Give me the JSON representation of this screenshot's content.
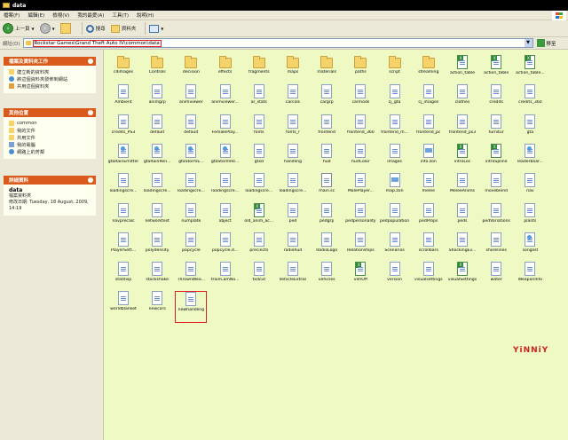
{
  "window": {
    "title": "data"
  },
  "menu": [
    "檔案(F)",
    "編輯(E)",
    "檢視(V)",
    "我的最愛(A)",
    "工具(T)",
    "說明(H)"
  ],
  "toolbar": {
    "back": "上一頁",
    "search": "搜尋",
    "folders": "資料夾"
  },
  "address": {
    "label": "網址(D)",
    "path": "Rockstar Games\\Grand Theft Auto IV\\common\\data",
    "go": "移至"
  },
  "tasks_panel": {
    "title": "檔案及資料夾工作",
    "items": [
      "建立新的資料夾",
      "將這個資料夾發佈到網站",
      "共用這個資料夾"
    ]
  },
  "other_panel": {
    "title": "其他位置",
    "items": [
      "common",
      "我的文件",
      "共用文件",
      "我的電腦",
      "網路上的芳鄰"
    ]
  },
  "details_panel": {
    "title": "詳細資料",
    "name": "data",
    "type": "檔案資料夾",
    "modified": "修改日期: Tuesday, 18 August, 2009, 14:19"
  },
  "watermark": "YiNNiY",
  "files": [
    {
      "label": "cdimages",
      "kind": "folder"
    },
    {
      "label": "Controls",
      "kind": "folder"
    },
    {
      "label": "decision",
      "kind": "folder"
    },
    {
      "label": "effects",
      "kind": "folder"
    },
    {
      "label": "fragments",
      "kind": "folder"
    },
    {
      "label": "maps",
      "kind": "folder"
    },
    {
      "label": "materials",
      "kind": "folder"
    },
    {
      "label": "paths",
      "kind": "folder"
    },
    {
      "label": "script",
      "kind": "folder"
    },
    {
      "label": "streaming",
      "kind": "folder"
    },
    {
      "label": "action_table",
      "kind": "xls"
    },
    {
      "label": "action_table",
      "kind": "xls"
    },
    {
      "label": "action_table...",
      "kind": "xls"
    },
    {
      "label": "Ambient",
      "kind": "file"
    },
    {
      "label": "animgrp",
      "kind": "file"
    },
    {
      "label": "animviewer",
      "kind": "file"
    },
    {
      "label": "animviewer...",
      "kind": "file"
    },
    {
      "label": "ar_stats",
      "kind": "file"
    },
    {
      "label": "carcols",
      "kind": "file"
    },
    {
      "label": "cargrp",
      "kind": "file"
    },
    {
      "label": "carmods",
      "kind": "file"
    },
    {
      "label": "cj_gta",
      "kind": "file"
    },
    {
      "label": "cj_images",
      "kind": "file"
    },
    {
      "label": "clothes",
      "kind": "file"
    },
    {
      "label": "credits",
      "kind": "file"
    },
    {
      "label": "credits_360",
      "kind": "file"
    },
    {
      "label": "credits_PS3",
      "kind": "file"
    },
    {
      "label": "default",
      "kind": "file"
    },
    {
      "label": "default",
      "kind": "file"
    },
    {
      "label": "FemalePlay...",
      "kind": "file"
    },
    {
      "label": "fonts",
      "kind": "file"
    },
    {
      "label": "fonts_r",
      "kind": "file"
    },
    {
      "label": "frontend",
      "kind": "file"
    },
    {
      "label": "frontend_360",
      "kind": "file"
    },
    {
      "label": "frontend_m...",
      "kind": "file"
    },
    {
      "label": "frontend_pc",
      "kind": "file"
    },
    {
      "label": "frontend_ps3",
      "kind": "file"
    },
    {
      "label": "furnitur",
      "kind": "file"
    },
    {
      "label": "gta",
      "kind": "file"
    },
    {
      "label": "gtaRainEmitter",
      "kind": "cfg"
    },
    {
      "label": "gtaRainRen...",
      "kind": "cfg"
    },
    {
      "label": "gtaStormE...",
      "kind": "cfg"
    },
    {
      "label": "gtaStormRe...",
      "kind": "cfg"
    },
    {
      "label": "gtxd",
      "kind": "file"
    },
    {
      "label": "handling",
      "kind": "file"
    },
    {
      "label": "hud",
      "kind": "file"
    },
    {
      "label": "hudColor",
      "kind": "file"
    },
    {
      "label": "images",
      "kind": "file"
    },
    {
      "label": "info.zon",
      "kind": "img"
    },
    {
      "label": "introLoc",
      "kind": "xls"
    },
    {
      "label": "introSpline",
      "kind": "xls"
    },
    {
      "label": "leaderboar...",
      "kind": "cfg"
    },
    {
      "label": "loadingscre...",
      "kind": "file"
    },
    {
      "label": "loadingscre...",
      "kind": "file"
    },
    {
      "label": "loadingscre...",
      "kind": "file"
    },
    {
      "label": "loadingscre...",
      "kind": "file"
    },
    {
      "label": "loadingscre...",
      "kind": "file"
    },
    {
      "label": "loadingscre...",
      "kind": "file"
    },
    {
      "label": "main.sc",
      "kind": "ini"
    },
    {
      "label": "MalePlayer...",
      "kind": "file"
    },
    {
      "label": "map.zon",
      "kind": "img"
    },
    {
      "label": "melee",
      "kind": "file"
    },
    {
      "label": "MeleeAnims",
      "kind": "file"
    },
    {
      "label": "moveblend",
      "kind": "file"
    },
    {
      "label": "nav",
      "kind": "file"
    },
    {
      "label": "navprecalc",
      "kind": "file"
    },
    {
      "label": "networktest",
      "kind": "file"
    },
    {
      "label": "numplate",
      "kind": "file"
    },
    {
      "label": "object",
      "kind": "file"
    },
    {
      "label": "old_anim_ac...",
      "kind": "xls"
    },
    {
      "label": "ped",
      "kind": "file"
    },
    {
      "label": "pedgrp",
      "kind": "file"
    },
    {
      "label": "pedpersonality",
      "kind": "file"
    },
    {
      "label": "pedpopulation",
      "kind": "file"
    },
    {
      "label": "pedProps",
      "kind": "file"
    },
    {
      "label": "peds",
      "kind": "file"
    },
    {
      "label": "pedVariations",
      "kind": "file"
    },
    {
      "label": "plants",
      "kind": "file"
    },
    {
      "label": "PlayerSett...",
      "kind": "file"
    },
    {
      "label": "polydensity",
      "kind": "file"
    },
    {
      "label": "popcycle",
      "kind": "file"
    },
    {
      "label": "popcycle.d...",
      "kind": "file"
    },
    {
      "label": "precincts",
      "kind": "file"
    },
    {
      "label": "radiohud",
      "kind": "file"
    },
    {
      "label": "RadioLogo",
      "kind": "file"
    },
    {
      "label": "Relationships",
      "kind": "file"
    },
    {
      "label": "Scenarios",
      "kind": "file"
    },
    {
      "label": "scrollbars",
      "kind": "file"
    },
    {
      "label": "ShockingEv...",
      "kind": "file"
    },
    {
      "label": "shorelines",
      "kind": "file"
    },
    {
      "label": "songlist",
      "kind": "cfg"
    },
    {
      "label": "statdisp",
      "kind": "file"
    },
    {
      "label": "stockshake",
      "kind": "file"
    },
    {
      "label": "ThrownWea...",
      "kind": "file"
    },
    {
      "label": "trainCamNo...",
      "kind": "file"
    },
    {
      "label": "txdcut",
      "kind": "file"
    },
    {
      "label": "VehicleExtras",
      "kind": "file"
    },
    {
      "label": "vehicles",
      "kind": "file"
    },
    {
      "label": "vehOff",
      "kind": "xls"
    },
    {
      "label": "version",
      "kind": "file"
    },
    {
      "label": "visualsettings",
      "kind": "file"
    },
    {
      "label": "visualSettings",
      "kind": "xls"
    },
    {
      "label": "water",
      "kind": "file"
    },
    {
      "label": "WeaponInfo",
      "kind": "file"
    },
    {
      "label": "worldblanket",
      "kind": "file"
    },
    {
      "label": "newcars",
      "kind": "file"
    },
    {
      "label": "newhandling",
      "kind": "file",
      "highlighted": true
    }
  ]
}
